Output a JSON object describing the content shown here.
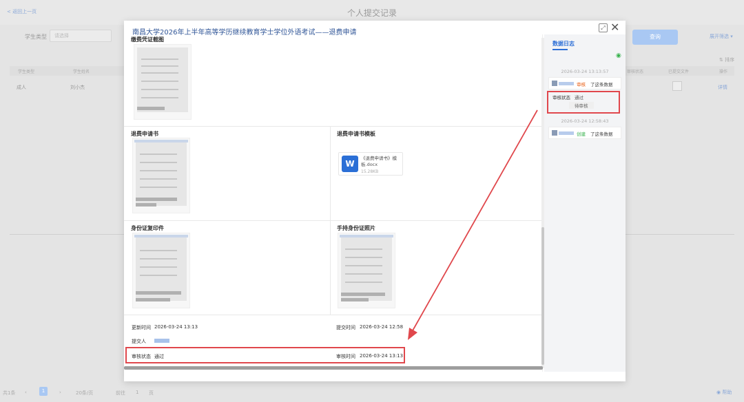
{
  "background": {
    "back_link": "< 返回上一页",
    "page_title": "个人提交记录",
    "filter_label": "学生类型",
    "filter_placeholder": "请选择",
    "query_button": "查询",
    "filter_toggle": "展开筛选 ▾",
    "sort_label": "⇅ 排序",
    "table_headers": [
      "学生类型",
      "学生姓名",
      "审核状态",
      "已提交文件",
      "操作"
    ],
    "row": {
      "type": "成人",
      "name": "刘小杰",
      "op": "详情"
    },
    "pager": {
      "total": "共1条",
      "current": "1",
      "page_size": "20条/页",
      "goto": "前往",
      "goto_page": "1",
      "page_suffix": "页"
    },
    "help": "帮助"
  },
  "modal": {
    "title": "南昌大学2026年上半年高等学历继续教育学士学位外语考试——退费申请",
    "sections": {
      "payment_receipt": "缴费凭证截图",
      "refund_application": "退费申请书",
      "refund_template": "退费申请书模板",
      "id_copy": "身份证复印件",
      "id_photo": "手持身份证照片"
    },
    "template_file": {
      "name": "《退费申请书》模板.docx",
      "size": "15.28KB",
      "icon_letter": "W"
    },
    "meta": {
      "update_time_label": "更新时间",
      "update_time": "2026-03-24 13:13",
      "submit_time_label": "提交时间",
      "submit_time": "2026-03-24 12:58",
      "submitter_label": "提交人",
      "review_status_label": "审核状态",
      "review_status": "通过",
      "review_time_label": "审核时间",
      "review_time": "2026-03-24 13:13"
    }
  },
  "side": {
    "tab": "数据日志",
    "logs": [
      {
        "time": "2026-03-24 13:13:57",
        "action": "审核",
        "text": "了这条数据",
        "action_color": "#e8590c",
        "field_label": "审核状态",
        "new_value": "通过",
        "old_value": "待审核"
      },
      {
        "time": "2026-03-24 12:58:43",
        "action": "创建",
        "text": "了这条数据",
        "action_color": "#37b24d"
      }
    ]
  },
  "colors": {
    "accent": "#2d6fd6",
    "highlight": "#e0474c"
  }
}
